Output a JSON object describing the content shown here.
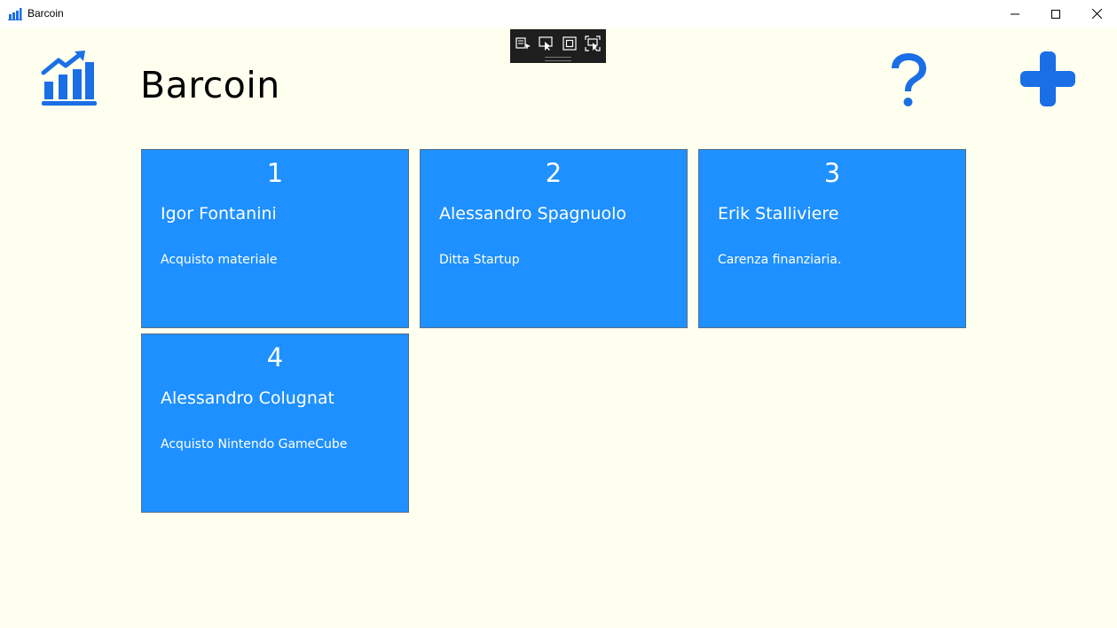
{
  "window": {
    "title": "Barcoin"
  },
  "header": {
    "title": "Barcoin",
    "logo_icon": "bar-chart-growth-icon",
    "help_icon": "question-mark-icon",
    "add_icon": "plus-icon",
    "accent_color": "#1a6fe6"
  },
  "cards": [
    {
      "number": "1",
      "name": "Igor Fontanini",
      "description": "Acquisto materiale"
    },
    {
      "number": "2",
      "name": "Alessandro Spagnuolo",
      "description": "Ditta Startup"
    },
    {
      "number": "3",
      "name": "Erik Stalliviere",
      "description": "Carenza finanziaria."
    },
    {
      "number": "4",
      "name": "Alessandro Colugnat",
      "description": "Acquisto Nintendo GameCube"
    }
  ],
  "colors": {
    "background": "#fffff0",
    "card": "#1e90ff",
    "card_text": "#ffffff"
  }
}
